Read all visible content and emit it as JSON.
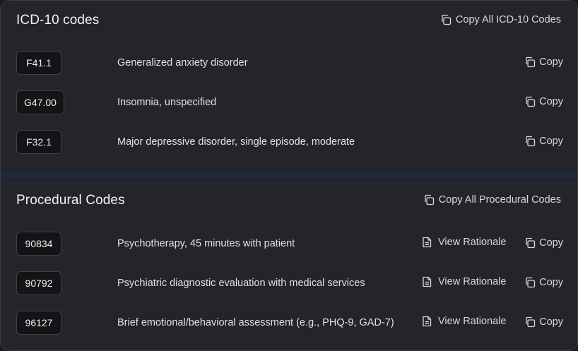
{
  "icd": {
    "title": "ICD-10 codes",
    "copy_all_label": "Copy All ICD-10 Codes",
    "copy_all_icon": "copy-icon",
    "rows": [
      {
        "code": "F41.1",
        "description": "Generalized anxiety disorder",
        "copy_label": "Copy"
      },
      {
        "code": "G47.00",
        "description": "Insomnia, unspecified",
        "copy_label": "Copy"
      },
      {
        "code": "F32.1",
        "description": "Major depressive disorder, single episode, moderate",
        "copy_label": "Copy"
      }
    ]
  },
  "procedural": {
    "title": "Procedural Codes",
    "copy_all_label": "Copy All Procedural Codes",
    "copy_all_icon": "copy-icon",
    "rationale_icon": "document-icon",
    "rows": [
      {
        "code": "90834",
        "description": "Psychotherapy, 45 minutes with patient",
        "rationale_label": "View Rationale",
        "copy_label": "Copy"
      },
      {
        "code": "90792",
        "description": "Psychiatric diagnostic evaluation with medical services",
        "rationale_label": "View Rationale",
        "copy_label": "Copy"
      },
      {
        "code": "96127",
        "description": "Brief emotional/behavioral assessment (e.g., PHQ-9, GAD-7)",
        "rationale_label": "View Rationale",
        "copy_label": "Copy"
      }
    ]
  },
  "colors": {
    "card_bg": "#242529",
    "code_chip_bg": "#141417",
    "divider": "#232a3f",
    "text": "#e6e6e8"
  }
}
